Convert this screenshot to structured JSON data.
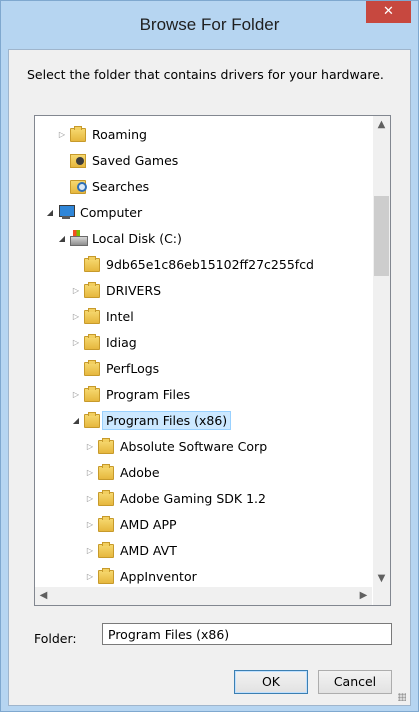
{
  "window": {
    "title": "Browse For Folder",
    "close_glyph": "✕"
  },
  "instruction": "Select the folder that contains drivers for your hardware.",
  "tree": {
    "items": [
      {
        "label": "Roaming",
        "icon": "folder-icon",
        "arrow": "collapsed"
      },
      {
        "label": "Saved Games",
        "icon": "saved-games-folder-icon",
        "arrow": "none"
      },
      {
        "label": "Searches",
        "icon": "searches-folder-icon",
        "arrow": "none"
      },
      {
        "label": "Computer",
        "icon": "computer-icon",
        "arrow": "expanded"
      },
      {
        "label": "Local Disk (C:)",
        "icon": "disk-icon",
        "arrow": "expanded"
      },
      {
        "label": "9db65e1c86eb15102ff27c255fcd",
        "icon": "folder-icon",
        "arrow": "none"
      },
      {
        "label": "DRIVERS",
        "icon": "folder-icon",
        "arrow": "collapsed"
      },
      {
        "label": "Intel",
        "icon": "folder-icon",
        "arrow": "collapsed"
      },
      {
        "label": "Idiag",
        "icon": "folder-icon",
        "arrow": "collapsed"
      },
      {
        "label": "PerfLogs",
        "icon": "folder-icon",
        "arrow": "none"
      },
      {
        "label": "Program Files",
        "icon": "folder-icon",
        "arrow": "collapsed"
      },
      {
        "label": "Program Files (x86)",
        "icon": "folder-icon",
        "arrow": "expanded",
        "selected": true
      },
      {
        "label": "Absolute Software Corp",
        "icon": "folder-icon",
        "arrow": "collapsed"
      },
      {
        "label": "Adobe",
        "icon": "folder-icon",
        "arrow": "collapsed"
      },
      {
        "label": "Adobe Gaming SDK 1.2",
        "icon": "folder-icon",
        "arrow": "collapsed"
      },
      {
        "label": "AMD APP",
        "icon": "folder-icon",
        "arrow": "collapsed"
      },
      {
        "label": "AMD AVT",
        "icon": "folder-icon",
        "arrow": "collapsed"
      },
      {
        "label": "AppInventor",
        "icon": "folder-icon",
        "arrow": "collapsed"
      }
    ]
  },
  "folder_field": {
    "label": "Folder:",
    "value": "Program Files (x86)"
  },
  "buttons": {
    "ok": "OK",
    "cancel": "Cancel"
  },
  "colors": {
    "title_bar": "#b6d5f1",
    "close_button": "#c7483f",
    "selection": "#cce8ff"
  }
}
